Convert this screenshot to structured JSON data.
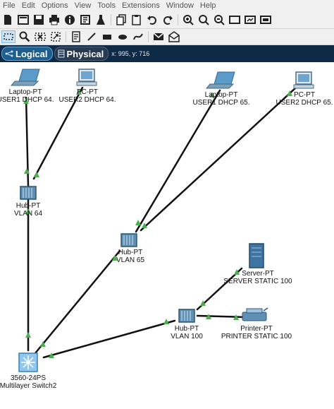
{
  "menu": [
    "File",
    "Edit",
    "Options",
    "View",
    "Tools",
    "Extensions",
    "Window",
    "Help"
  ],
  "toolbar1_icons": [
    "new-file-icon",
    "open-icon",
    "save-icon",
    "print-icon",
    "info-icon",
    "network-wizard-icon",
    "activity-wizard-icon",
    "copy-icon",
    "paste-icon",
    "undo-icon",
    "redo-icon",
    "zoom-in-icon",
    "zoom-reset-icon",
    "zoom-out-icon",
    "palette-icon",
    "custom-device-icon",
    "viewport-icon"
  ],
  "toolbar2_icons": [
    "select-icon",
    "inspect-icon",
    "delete-icon",
    "resize-icon",
    "note-icon",
    "draw-line-icon",
    "draw-rectangle-icon",
    "draw-ellipse-icon",
    "freeform-icon",
    "add-pdu-icon",
    "add-complex-pdu-icon"
  ],
  "modes": {
    "logical": "Logical",
    "physical": "Physical",
    "coords": "x: 995, y: 716"
  },
  "devices": {
    "laptop1": {
      "type": "Laptop-PT",
      "name": "USER1 DHCP 64."
    },
    "pc1": {
      "type": "PC-PT",
      "name": "USER2 DHCP 64."
    },
    "laptop2": {
      "type": "Laptop-PT",
      "name": "USER1 DHCP 65."
    },
    "pc2": {
      "type": "PC-PT",
      "name": "USER2 DHCP 65."
    },
    "hub64": {
      "type": "Hub-PT",
      "name": "VLAN 64"
    },
    "hub65": {
      "type": "Hub-PT",
      "name": "VLAN 65"
    },
    "hub100": {
      "type": "Hub-PT",
      "name": "VLAN 100"
    },
    "server": {
      "type": "Server-PT",
      "name": "SERVER STATIC 100"
    },
    "printer": {
      "type": "Printer-PT",
      "name": "PRINTER STATIC 100"
    },
    "switch": {
      "type": "3560-24PS",
      "name": "Multilayer Switch2"
    }
  },
  "colors": {
    "link": "#111111",
    "link_up": "#4caf50",
    "modebar": "#0e2a47",
    "device_blue": "#4a8bb8"
  }
}
